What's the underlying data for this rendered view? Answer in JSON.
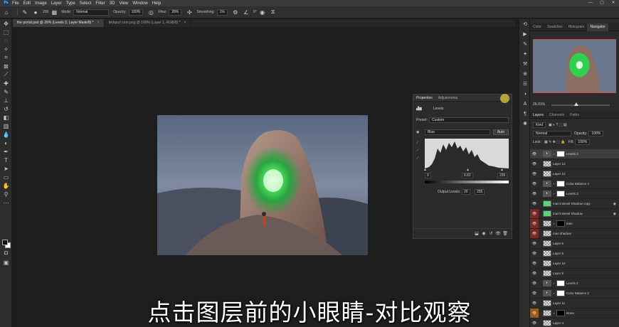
{
  "menubar": {
    "logo": "Ps",
    "items": [
      "File",
      "Edit",
      "Image",
      "Layer",
      "Type",
      "Select",
      "Filter",
      "3D",
      "View",
      "Window",
      "Help"
    ],
    "window_controls": [
      "—",
      "▢",
      "✕"
    ]
  },
  "options": {
    "brush_size": "200",
    "mode_label": "Mode:",
    "mode_value": "Normal",
    "opacity_label": "Opacity:",
    "opacity_value": "100%",
    "flow_label": "Flow:",
    "flow_value": "28%",
    "smoothing_label": "Smoothing:",
    "smoothing_value": "1%",
    "angle_value": "0°"
  },
  "doc_tabs": [
    {
      "label": "the portal.psd @ 26% (Levels 3, Layer Mask/8) *",
      "active": true
    },
    {
      "label": "blckpurl.com.png @ 100% (Layer 1, RGB/8) *",
      "active": false
    }
  ],
  "properties": {
    "tabs": [
      "Properties",
      "Adjustments"
    ],
    "panel_title": "Levels",
    "preset_label": "Preset:",
    "preset_value": "Custom",
    "channel_value": "Blue",
    "auto_label": "Auto",
    "input_black": "0",
    "input_mid": "0.82",
    "input_white": "226",
    "output_label": "Output Levels:",
    "output_black": "20",
    "output_white": "255"
  },
  "right_panel": {
    "tabs": [
      "Color",
      "Swatches",
      "Histogram",
      "Navigator"
    ],
    "active_tab": "Navigator",
    "zoom": "26.01%"
  },
  "layers_panel": {
    "tabs": [
      "Layers",
      "Channels",
      "Paths"
    ],
    "kind_label": "Kind",
    "blend_value": "Normal",
    "opacity_label": "Opacity:",
    "opacity_value": "100%",
    "lock_label": "Lock:",
    "fill_label": "Fill:",
    "fill_value": "100%",
    "layers": [
      {
        "name": "Levels 3",
        "eye": "normal",
        "thumb": "adj",
        "mask": "white",
        "selected": true
      },
      {
        "name": "Layer 12",
        "eye": "normal",
        "thumb": "checker"
      },
      {
        "name": "Layer 12",
        "eye": "normal",
        "thumb": "checker"
      },
      {
        "name": "Color Balance 4",
        "eye": "normal",
        "thumb": "adj",
        "mask": "white"
      },
      {
        "name": "Levels 3",
        "eye": "normal",
        "thumb": "adj",
        "mask": "white"
      },
      {
        "name": "man's Bevel Shadow copy",
        "eye": "normal",
        "thumb": "green",
        "fx": true
      },
      {
        "name": "man's Bevel Shadow",
        "eye": "red",
        "thumb": "green",
        "fx": true
      },
      {
        "name": "man",
        "eye": "red",
        "thumb": "checker",
        "mask": "black"
      },
      {
        "name": "man shadow",
        "eye": "red",
        "thumb": "checker"
      },
      {
        "name": "Layer 6",
        "eye": "normal",
        "thumb": "checker"
      },
      {
        "name": "Layer 5",
        "eye": "normal",
        "thumb": "checker"
      },
      {
        "name": "Layer 10",
        "eye": "normal",
        "thumb": "checker"
      },
      {
        "name": "Layer 5",
        "eye": "normal",
        "thumb": "checker"
      },
      {
        "name": "Levels 2",
        "eye": "normal",
        "thumb": "adj",
        "mask": "white"
      },
      {
        "name": "Color Balance 2",
        "eye": "normal",
        "thumb": "adj",
        "mask": "white"
      },
      {
        "name": "Layer 11",
        "eye": "normal",
        "thumb": "checker"
      },
      {
        "name": "stone",
        "eye": "orange",
        "thumb": "checker",
        "mask": "black"
      },
      {
        "name": "Layer 4",
        "eye": "normal",
        "thumb": "checker"
      }
    ]
  },
  "subtitle": "点击图层前的小眼睛-对比观察"
}
